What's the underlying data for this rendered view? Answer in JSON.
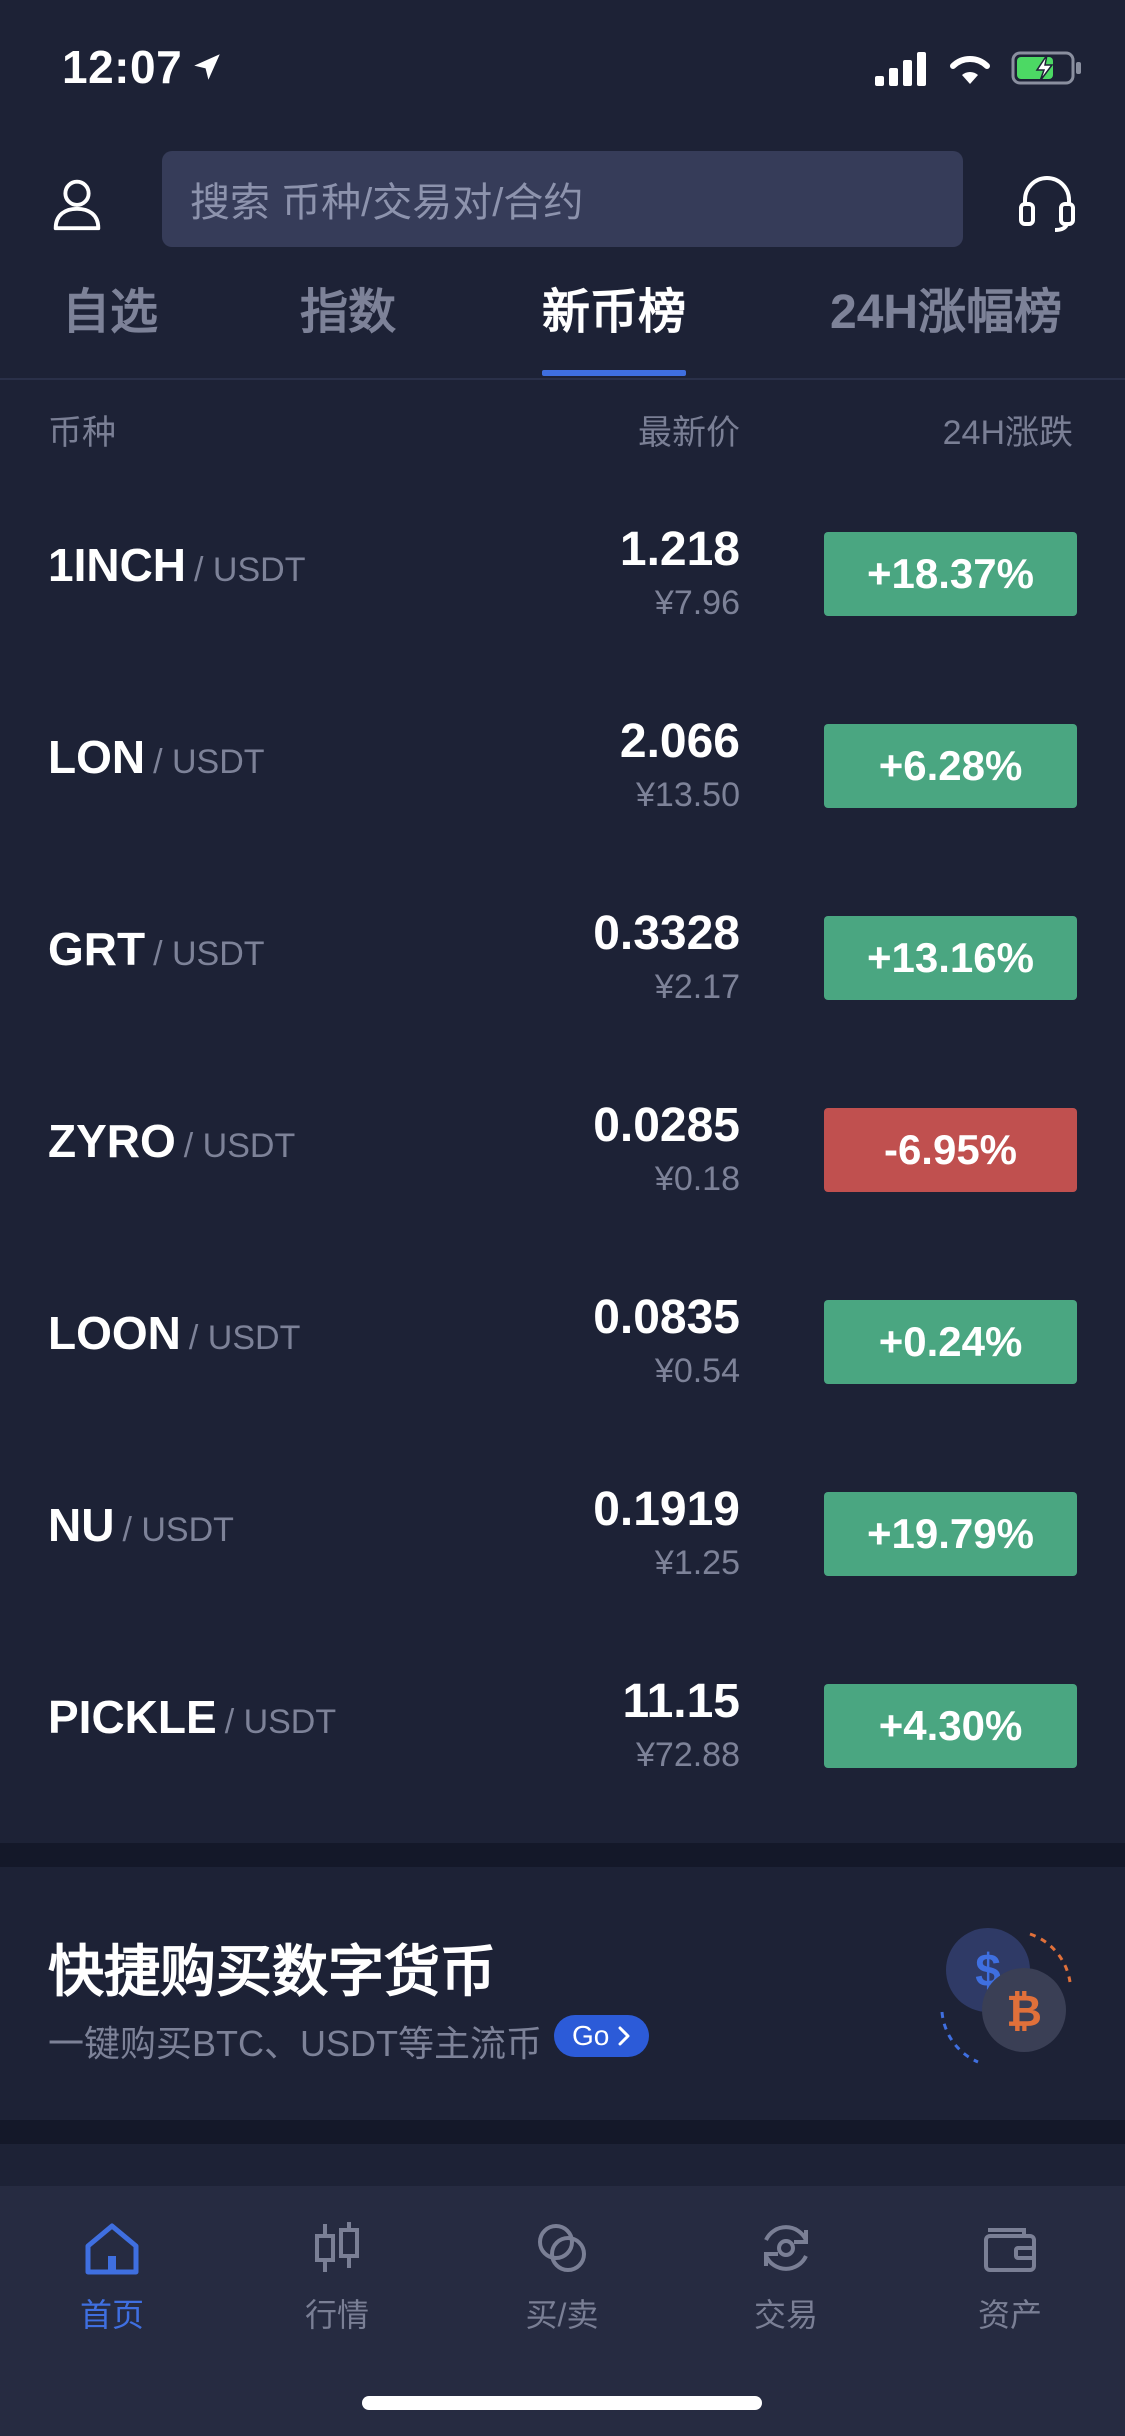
{
  "status_bar": {
    "time": "12:07"
  },
  "header": {
    "search_placeholder": "搜索 币种/交易对/合约"
  },
  "tabs": [
    {
      "label": "自选"
    },
    {
      "label": "指数"
    },
    {
      "label": "新币榜"
    },
    {
      "label": "24H涨幅榜"
    }
  ],
  "columns": {
    "coin": "币种",
    "price": "最新价",
    "change": "24H涨跌"
  },
  "rows": [
    {
      "base": "1INCH",
      "quote": "/ USDT",
      "price": "1.218",
      "cny": "¥7.96",
      "change": "+18.37%"
    },
    {
      "base": "LON",
      "quote": "/ USDT",
      "price": "2.066",
      "cny": "¥13.50",
      "change": "+6.28%"
    },
    {
      "base": "GRT",
      "quote": "/ USDT",
      "price": "0.3328",
      "cny": "¥2.17",
      "change": "+13.16%"
    },
    {
      "base": "ZYRO",
      "quote": "/ USDT",
      "price": "0.0285",
      "cny": "¥0.18",
      "change": "-6.95%"
    },
    {
      "base": "LOON",
      "quote": "/ USDT",
      "price": "0.0835",
      "cny": "¥0.54",
      "change": "+0.24%"
    },
    {
      "base": "NU",
      "quote": "/ USDT",
      "price": "0.1919",
      "cny": "¥1.25",
      "change": "+19.79%"
    },
    {
      "base": "PICKLE",
      "quote": "/ USDT",
      "price": "11.15",
      "cny": "¥72.88",
      "change": "+4.30%"
    }
  ],
  "colors": {
    "up": "#4aa681",
    "down": "#c0504f",
    "accent": "#3f6fe0"
  },
  "promo": {
    "title": "快捷购买数字货币",
    "subtitle": "一键购买BTC、USDT等主流币",
    "go_label": "Go"
  },
  "nav": [
    {
      "label": "首页",
      "icon": "home-icon"
    },
    {
      "label": "行情",
      "icon": "candlestick-icon"
    },
    {
      "label": "买/卖",
      "icon": "buy-sell-icon"
    },
    {
      "label": "交易",
      "icon": "trade-icon"
    },
    {
      "label": "资产",
      "icon": "wallet-icon"
    }
  ]
}
